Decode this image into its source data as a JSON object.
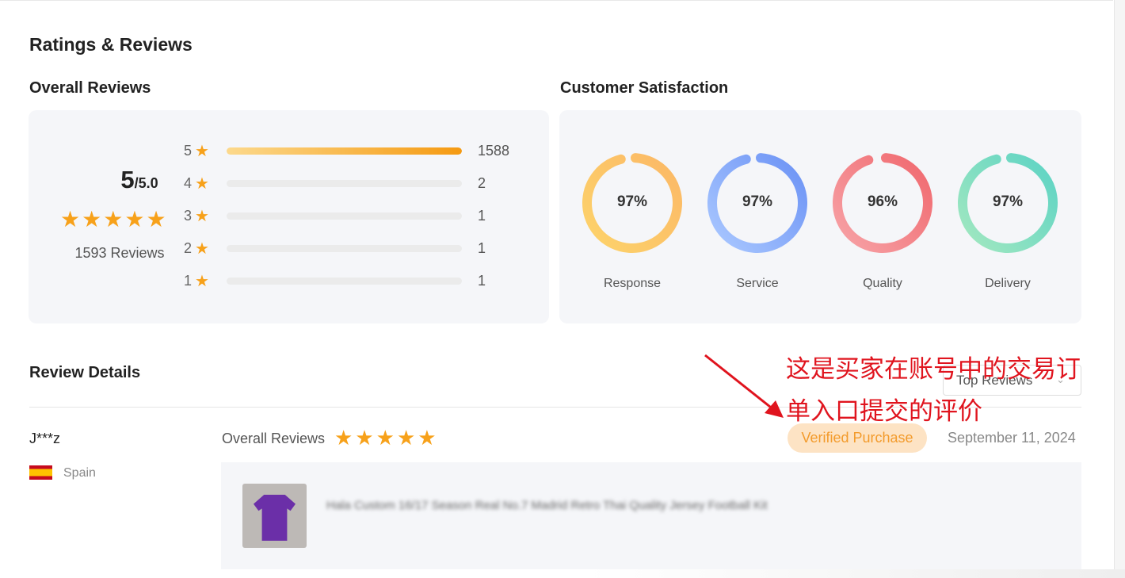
{
  "page": {
    "title": "Ratings & Reviews"
  },
  "overall": {
    "title": "Overall Reviews",
    "score": "5",
    "max": "/5.0",
    "average_stars": 5,
    "count_label": "1593 Reviews",
    "rows": [
      {
        "stars": "5",
        "count": "1588",
        "fraction": 1.0
      },
      {
        "stars": "4",
        "count": "2",
        "fraction": 0.0013
      },
      {
        "stars": "3",
        "count": "1",
        "fraction": 0.0006
      },
      {
        "stars": "2",
        "count": "1",
        "fraction": 0.0006
      },
      {
        "stars": "1",
        "count": "1",
        "fraction": 0.0006
      }
    ]
  },
  "satisfaction": {
    "title": "Customer Satisfaction",
    "items": [
      {
        "label": "Response",
        "value": "97%",
        "percent": 97,
        "colors": [
          "#fdd36b",
          "#fbb866"
        ]
      },
      {
        "label": "Service",
        "value": "97%",
        "percent": 97,
        "colors": [
          "#aac8ff",
          "#6b92f5"
        ]
      },
      {
        "label": "Quality",
        "value": "96%",
        "percent": 96,
        "colors": [
          "#f7a3a7",
          "#f0686e"
        ]
      },
      {
        "label": "Delivery",
        "value": "97%",
        "percent": 97,
        "colors": [
          "#a3e8c0",
          "#5cd3c4"
        ]
      }
    ]
  },
  "details": {
    "title": "Review Details",
    "sort": "Top Reviews",
    "annotation": [
      "这是买家在账号中的交易订",
      "单入口提交的评价"
    ],
    "review": {
      "user": "J***z",
      "country": "Spain",
      "overall_label": "Overall Reviews",
      "stars": 5,
      "badge": "Verified Purchase",
      "date": "September 11, 2024",
      "product_title": "Hala Custom 16/17 Season Real No.7 Madrid Retro Thai Quality Jersey Football Kit"
    }
  }
}
